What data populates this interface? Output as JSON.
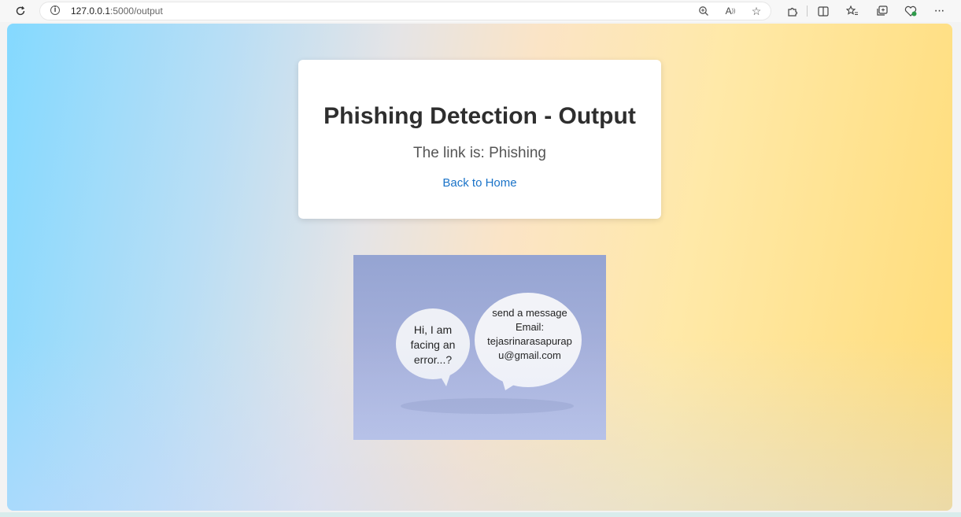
{
  "browser": {
    "url_host": "127.0.0.1",
    "url_path": ":5000/output",
    "icons": {
      "reload": "reload-icon",
      "site_info": "info-icon",
      "zoom": "zoom-icon",
      "read_aloud": "read-aloud-icon",
      "favorite": "star-icon",
      "extensions": "puzzle-icon",
      "split_screen": "split-screen-icon",
      "favorites": "favorites-icon",
      "collections": "collections-icon",
      "browser_essentials": "heart-icon",
      "more": "more-icon"
    }
  },
  "card": {
    "title": "Phishing Detection - Output",
    "result_text": "The link is: Phishing",
    "back_link": "Back to Home"
  },
  "image": {
    "bubble_small": [
      "Hi, I am",
      "facing an",
      "error...?"
    ],
    "bubble_large": [
      "send a message",
      "Email:",
      "tejasrinarasapurap",
      "u@gmail.com"
    ]
  },
  "colors": {
    "link": "#1a73c8",
    "title": "#2e2e2e"
  }
}
